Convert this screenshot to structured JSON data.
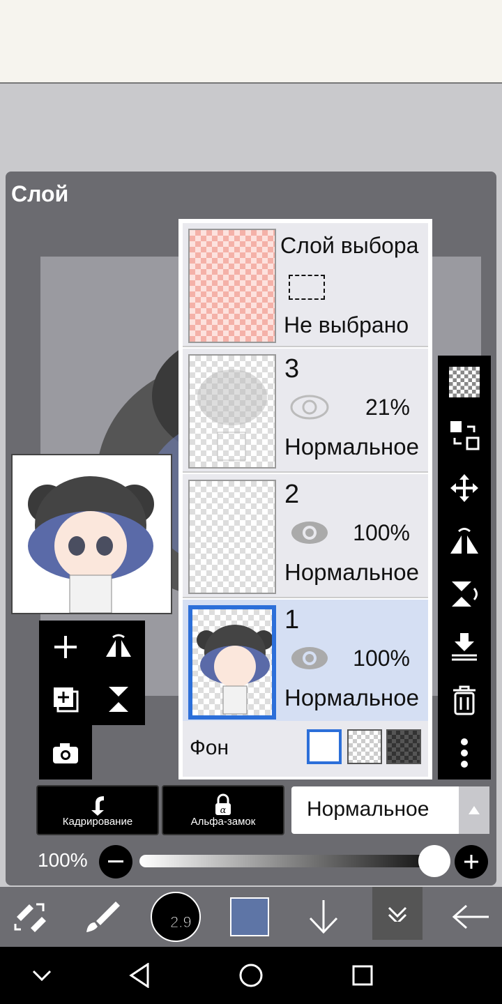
{
  "panel": {
    "title": "Слой"
  },
  "selection_layer": {
    "title": "Слой выбора",
    "status": "Не выбрано"
  },
  "layers": [
    {
      "number": "3",
      "opacity": "21%",
      "mode": "Нормальное"
    },
    {
      "number": "2",
      "opacity": "100%",
      "mode": "Нормальное"
    },
    {
      "number": "1",
      "opacity": "100%",
      "mode": "Нормальное",
      "selected": true
    }
  ],
  "background": {
    "label": "Фон"
  },
  "actions": {
    "crop_label": "Кадрирование",
    "alpha_lock_label": "Альфа-замок"
  },
  "blend_mode": {
    "value": "Нормальное"
  },
  "opacity": {
    "value_label": "100%",
    "value": 1.0
  },
  "brush": {
    "size_label": "2.9"
  },
  "colors": {
    "current": "#5e75a6",
    "selection": "#2c6fd9",
    "panel": "#6b6b70"
  },
  "icons": {
    "sidebar": [
      "transparency-icon",
      "transform-icon",
      "move-icon",
      "flip-horizontal-icon",
      "flip-vertical-icon",
      "merge-down-icon",
      "delete-icon",
      "more-icon"
    ],
    "toolbox": [
      "add-layer-icon",
      "flip-h-icon",
      "copy-layer-icon",
      "flip-v-icon",
      "camera-icon"
    ],
    "bottom": [
      "swap-tool-icon",
      "brush-icon",
      "brush-size-icon",
      "color-swatch-icon",
      "download-icon",
      "collapse-icon",
      "back-arrow-icon"
    ],
    "nav": [
      "hide-nav-icon",
      "back-icon",
      "home-icon",
      "recents-icon"
    ]
  }
}
